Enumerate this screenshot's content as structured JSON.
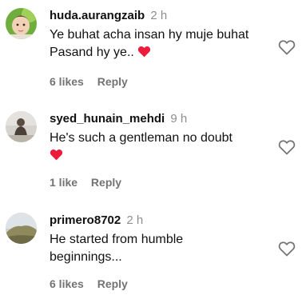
{
  "comments": [
    {
      "username": "huda.aurangzaib",
      "time": "2 h",
      "text": "Ye buhat acha insan hy muje buhat Pasand hy ye..",
      "likes": "6 likes",
      "reply": "Reply",
      "emoji": "red-heart"
    },
    {
      "username": "syed_hunain_mehdi",
      "time": "9 h",
      "text": "He's such a gentleman no doubt",
      "likes": "1 like",
      "reply": "Reply",
      "emoji": "red-heart"
    },
    {
      "username": "primero8702",
      "time": "2 h",
      "text": "He started from humble beginnings...",
      "likes": "6 likes",
      "reply": "Reply"
    }
  ],
  "colors": {
    "heart": "#ed1c3a",
    "muted": "#737373",
    "timestamp": "#8e8e8e"
  },
  "icons": {
    "like": "heart-outline-icon",
    "emoji": "red-heart-emoji"
  }
}
